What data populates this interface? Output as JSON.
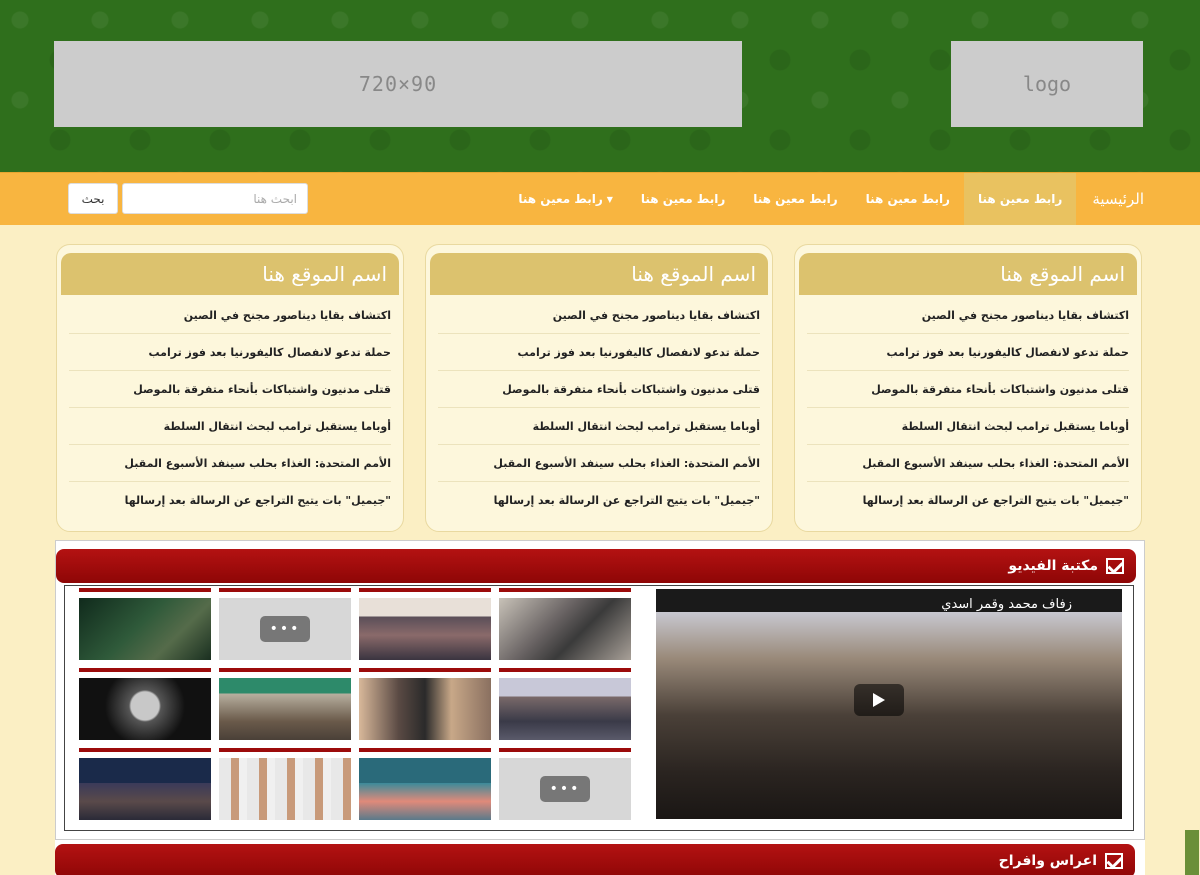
{
  "header": {
    "ad_text": "720×90",
    "logo_text": "logo"
  },
  "nav": {
    "items": [
      {
        "label": "الرئيسية"
      },
      {
        "label": "رابط معين هنا"
      },
      {
        "label": "رابط معين هنا"
      },
      {
        "label": "رابط معين هنا"
      },
      {
        "label": "رابط معين هنا"
      },
      {
        "label": "رابط معين هنا"
      }
    ],
    "active_index": 1,
    "dropdown_index": 5
  },
  "search": {
    "placeholder": "ابحث هنا",
    "button_label": "بحث"
  },
  "news_boxes": [
    {
      "title": "اسم الموقع هنا",
      "items": [
        "اكتشاف بقايا ديناصور مجنح في الصين",
        "حملة تدعو لانفصال كاليفورنيا بعد فوز ترامب",
        "قتلى مدنيون واشتباكات بأنحاء متفرقة بالموصل",
        "أوباما يستقبل ترامب لبحث انتقال السلطة",
        "الأمم المتحدة: الغذاء بحلب سينفد الأسبوع المقبل",
        "\"جيميل\" بات يتيح التراجع عن الرسالة بعد إرسالها"
      ]
    },
    {
      "title": "اسم الموقع هنا",
      "items": [
        "اكتشاف بقايا ديناصور مجنح في الصين",
        "حملة تدعو لانفصال كاليفورنيا بعد فوز ترامب",
        "قتلى مدنيون واشتباكات بأنحاء متفرقة بالموصل",
        "أوباما يستقبل ترامب لبحث انتقال السلطة",
        "الأمم المتحدة: الغذاء بحلب سينفد الأسبوع المقبل",
        "\"جيميل\" بات يتيح التراجع عن الرسالة بعد إرسالها"
      ]
    },
    {
      "title": "اسم الموقع هنا",
      "items": [
        "اكتشاف بقايا ديناصور مجنح في الصين",
        "حملة تدعو لانفصال كاليفورنيا بعد فوز ترامب",
        "قتلى مدنيون واشتباكات بأنحاء متفرقة بالموصل",
        "أوباما يستقبل ترامب لبحث انتقال السلطة",
        "الأمم المتحدة: الغذاء بحلب سينفد الأسبوع المقبل",
        "\"جيميل\" بات يتيح التراجع عن الرسالة بعد إرسالها"
      ]
    }
  ],
  "video_section": {
    "title": "مكتبة الفيديو",
    "main_video_caption": "زفاف محمد وقمر اسدي"
  },
  "section2": {
    "title": "اعراس وافراح"
  },
  "colors": {
    "header_green": "#2f6f1c",
    "nav_orange": "#f8b540",
    "nav_active": "#e9c260",
    "box_title": "#dcc26e",
    "section_red": "#9c0b0b"
  }
}
